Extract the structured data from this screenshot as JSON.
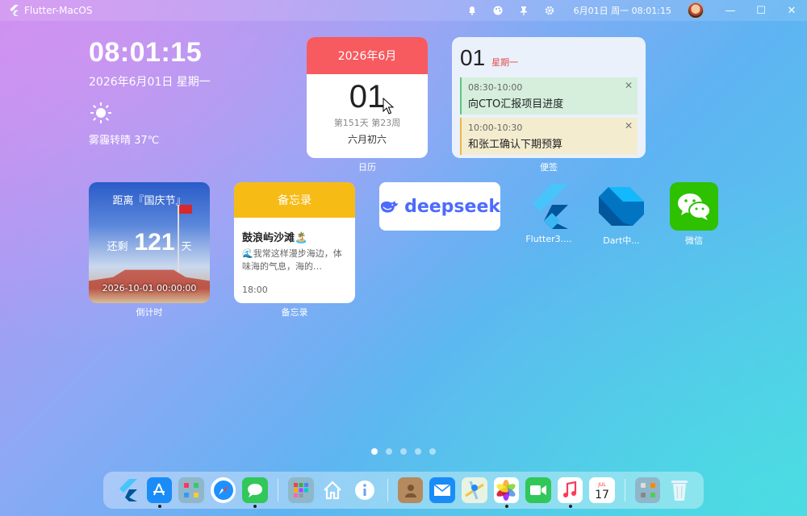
{
  "topbar": {
    "title": "Flutter-MacOS",
    "clock": "6月01日 周一 08:01:15",
    "tray_icons": [
      "bell-icon",
      "palette-icon",
      "pin-icon",
      "gear-icon"
    ],
    "window_controls": [
      "—",
      "☐",
      "✕"
    ]
  },
  "clock_widget": {
    "time": "08:01:15",
    "date": "2026年6月01日 星期一",
    "weather": "雾霾转晴 37℃"
  },
  "calendar_widget": {
    "header": "2026年6月",
    "day": "01",
    "sub": "第151天 第23周",
    "lunar": "六月初六",
    "label": "日历"
  },
  "notes_widget": {
    "day": "01",
    "weekday": "星期一",
    "items": [
      {
        "time": "08:30-10:00",
        "text": "向CTO汇报项目进度"
      },
      {
        "time": "10:00-10:30",
        "text": "和张工确认下期预算"
      }
    ],
    "label": "便签"
  },
  "countdown_widget": {
    "title": "距离『国庆节』",
    "prefix": "还剩",
    "days": "121",
    "suffix": "天",
    "target": "2026-10-01 00:00:00",
    "label": "倒计时"
  },
  "memo_widget": {
    "header": "备忘录",
    "title": "鼓浪屿沙滩🏝️",
    "body": "🌊我常这样漫步海边，体味海的气息，海的…",
    "time": "18:00",
    "label": "备忘录"
  },
  "apps": {
    "deepseek": "deepseek",
    "flutter_label": "Flutter3....",
    "dart_label": "Dart中...",
    "wechat_label": "微信"
  },
  "pages": {
    "count": 5,
    "active": 0
  },
  "colors": {
    "calendar_red": "#f75a5f",
    "memo_yellow": "#f7bb16",
    "wechat_green": "#2dc100",
    "deepseek_blue": "#4d6bfe"
  }
}
